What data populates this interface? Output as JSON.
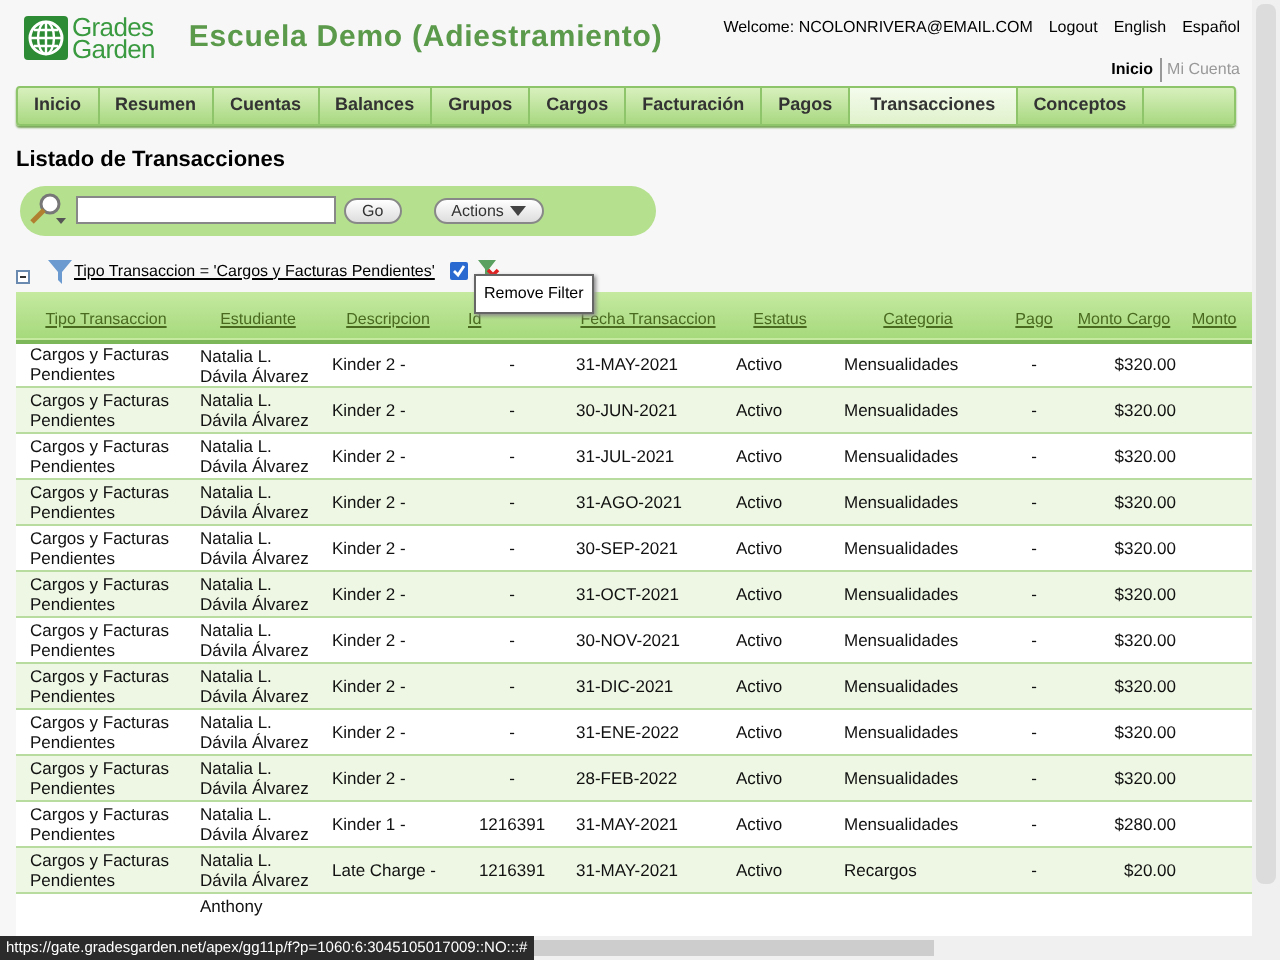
{
  "logo": {
    "line_1": "Grades",
    "line_2": "Garden"
  },
  "school_title": "Escuela Demo (Adiestramiento)",
  "user_links": [
    {
      "label": "Welcome: NCOLONRIVERA@EMAIL.COM",
      "kind": "text"
    },
    {
      "label": "Logout",
      "kind": "link"
    },
    {
      "label": "English",
      "kind": "link"
    },
    {
      "label": "Español",
      "kind": "link"
    }
  ],
  "account_nav": [
    {
      "label": "Inicio",
      "selected": true
    },
    {
      "label": "Mi Cuenta",
      "selected": false
    }
  ],
  "tabs": [
    {
      "label": "Inicio",
      "selected": false
    },
    {
      "label": "Resumen",
      "selected": false
    },
    {
      "label": "Cuentas",
      "selected": false
    },
    {
      "label": "Balances",
      "selected": false
    },
    {
      "label": "Grupos",
      "selected": false
    },
    {
      "label": "Cargos",
      "selected": false
    },
    {
      "label": "Facturación",
      "selected": false
    },
    {
      "label": "Pagos",
      "selected": false
    },
    {
      "label": "Transacciones",
      "selected": true
    },
    {
      "label": "Conceptos",
      "selected": false
    }
  ],
  "page_title": "Listado de Transacciones",
  "search": {
    "go_button": "Go",
    "actions_button": "Actions"
  },
  "filter": {
    "label": "Tipo Transaccion = 'Cargos y Facturas Pendientes'",
    "checked": true,
    "tooltip": "Remove Filter"
  },
  "table": {
    "columns": [
      "Tipo Transaccion",
      "Estudiante",
      "Descripcion",
      "Id",
      "Fecha Transaccion",
      "Estatus",
      "Categoria",
      "Pago",
      "Monto Cargo",
      "Monto"
    ],
    "rows": [
      [
        "Cargos y Facturas Pendientes",
        "Natalia L. Dávila Álvarez",
        "Kinder 2 -",
        "-",
        "31-MAY-2021",
        "Activo",
        "Mensualidades",
        "-",
        "$320.00"
      ],
      [
        "Cargos y Facturas Pendientes",
        "Natalia L. Dávila Álvarez",
        "Kinder 2 -",
        "-",
        "30-JUN-2021",
        "Activo",
        "Mensualidades",
        "-",
        "$320.00"
      ],
      [
        "Cargos y Facturas Pendientes",
        "Natalia L. Dávila Álvarez",
        "Kinder 2 -",
        "-",
        "31-JUL-2021",
        "Activo",
        "Mensualidades",
        "-",
        "$320.00"
      ],
      [
        "Cargos y Facturas Pendientes",
        "Natalia L. Dávila Álvarez",
        "Kinder 2 -",
        "-",
        "31-AGO-2021",
        "Activo",
        "Mensualidades",
        "-",
        "$320.00"
      ],
      [
        "Cargos y Facturas Pendientes",
        "Natalia L. Dávila Álvarez",
        "Kinder 2 -",
        "-",
        "30-SEP-2021",
        "Activo",
        "Mensualidades",
        "-",
        "$320.00"
      ],
      [
        "Cargos y Facturas Pendientes",
        "Natalia L. Dávila Álvarez",
        "Kinder 2 -",
        "-",
        "31-OCT-2021",
        "Activo",
        "Mensualidades",
        "-",
        "$320.00"
      ],
      [
        "Cargos y Facturas Pendientes",
        "Natalia L. Dávila Álvarez",
        "Kinder 2 -",
        "-",
        "30-NOV-2021",
        "Activo",
        "Mensualidades",
        "-",
        "$320.00"
      ],
      [
        "Cargos y Facturas Pendientes",
        "Natalia L. Dávila Álvarez",
        "Kinder 2 -",
        "-",
        "31-DIC-2021",
        "Activo",
        "Mensualidades",
        "-",
        "$320.00"
      ],
      [
        "Cargos y Facturas Pendientes",
        "Natalia L. Dávila Álvarez",
        "Kinder 2 -",
        "-",
        "31-ENE-2022",
        "Activo",
        "Mensualidades",
        "-",
        "$320.00"
      ],
      [
        "Cargos y Facturas Pendientes",
        "Natalia L. Dávila Álvarez",
        "Kinder 2 -",
        "-",
        "28-FEB-2022",
        "Activo",
        "Mensualidades",
        "-",
        "$320.00"
      ],
      [
        "Cargos y Facturas Pendientes",
        "Natalia L. Dávila Álvarez",
        "Kinder 1 -",
        "1216391",
        "31-MAY-2021",
        "Activo",
        "Mensualidades",
        "-",
        "$280.00"
      ],
      [
        "Cargos y Facturas Pendientes",
        "Natalia L. Dávila Álvarez",
        "Late Charge -",
        "1216391",
        "31-MAY-2021",
        "Activo",
        "Recargos",
        "-",
        "$20.00"
      ],
      [
        "",
        "Anthony",
        "",
        "",
        "",
        "",
        "",
        "",
        ""
      ]
    ]
  },
  "status_bar": "https://gate.gradesgarden.net/apex/gg11p/f?p=1060:6:3045105017009::NO:::#"
}
